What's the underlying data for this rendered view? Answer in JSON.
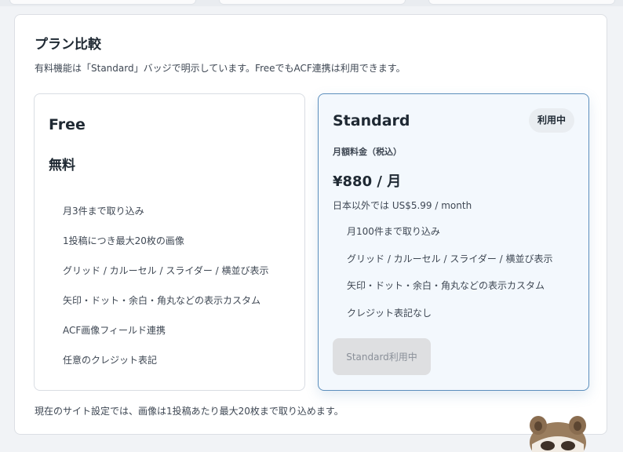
{
  "section": {
    "title": "プラン比較",
    "description": "有料機能は「Standard」バッジで明示しています。FreeでもACF連携は利用できます。",
    "footer": "現在のサイト設定では、画像は1投稿あたり最大20枚まで取り込めます。"
  },
  "plans": [
    {
      "name": "Free",
      "price": "無料",
      "features": [
        "月3件まで取り込み",
        "1投稿につき最大20枚の画像",
        "グリッド / カルーセル / スライダー / 横並び表示",
        "矢印・ドット・余白・角丸などの表示カスタム",
        "ACF画像フィールド連携",
        "任意のクレジット表記"
      ]
    },
    {
      "name": "Standard",
      "badge": "利用中",
      "price_label": "月額料金（税込）",
      "price": "¥880 / 月",
      "price_note": "日本以外では US$5.99 / month",
      "features": [
        "月100件まで取り込み",
        "グリッド / カルーセル / スライダー / 横並び表示",
        "矢印・ドット・余白・角丸などの表示カスタム",
        "クレジット表記なし"
      ],
      "button_label": "Standard利用中"
    }
  ],
  "colors": {
    "accent_border": "#5d8fbd",
    "standard_bg": "#f3f8fd",
    "badge_bg": "#e9edf1",
    "button_disabled_bg": "#dedfe1"
  }
}
